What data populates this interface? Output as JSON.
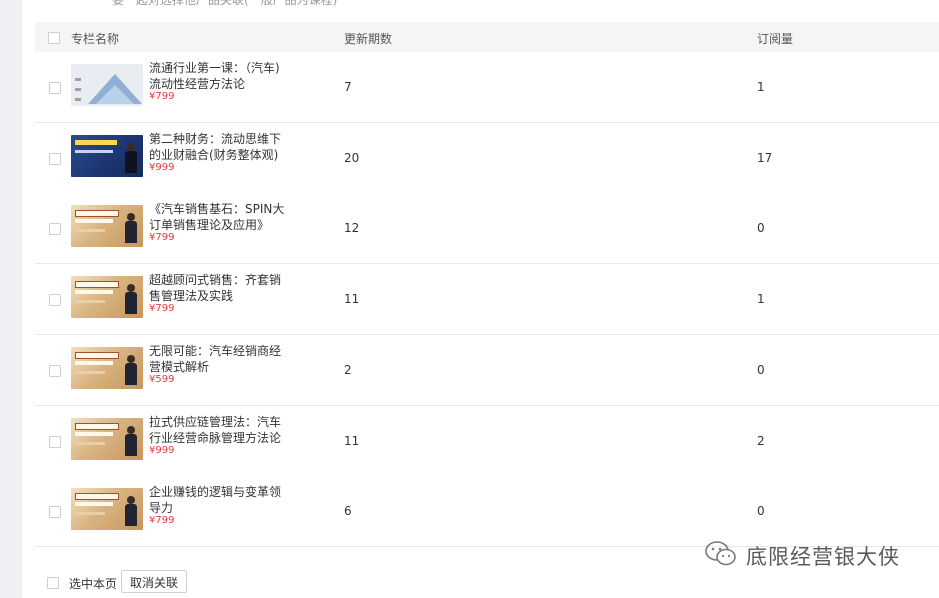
{
  "top_note": "要一起对选择他产品关联(一般产品为课程)",
  "table": {
    "headers": {
      "name": "专栏名称",
      "updates": "更新期数",
      "subscriptions": "订阅量"
    },
    "rows": [
      {
        "title": "流通行业第一课：（汽车)流动性经营方法论",
        "price": "¥799",
        "updates": "7",
        "subscriptions": "1",
        "thumb": "pyramid-diagram"
      },
      {
        "title": "第二种财务：流动思维下的业财融合(财务整体观)",
        "price": "¥999",
        "updates": "20",
        "subscriptions": "17",
        "thumb": "blue-cover"
      },
      {
        "title": "《汽车销售基石：SPIN大订单销售理论及应用》",
        "price": "¥799",
        "updates": "12",
        "subscriptions": "0",
        "thumb": "gold-cover"
      },
      {
        "title": "超越顾问式销售：齐套销售管理法及实践",
        "price": "¥799",
        "updates": "11",
        "subscriptions": "1",
        "thumb": "gold-cover"
      },
      {
        "title": "无限可能：汽车经销商经营模式解析",
        "price": "¥599",
        "updates": "2",
        "subscriptions": "0",
        "thumb": "gold-cover"
      },
      {
        "title": "拉式供应链管理法：汽车行业经营命脉管理方法论",
        "price": "¥999",
        "updates": "11",
        "subscriptions": "2",
        "thumb": "gold-cover"
      },
      {
        "title": "企业赚钱的逻辑与变革领导力",
        "price": "¥799",
        "updates": "6",
        "subscriptions": "0",
        "thumb": "gold-cover"
      }
    ]
  },
  "footer": {
    "select_page_label": "选中本页",
    "unlink_button": "取消关联"
  },
  "watermark": {
    "text": "底限经营银大侠",
    "icon": "wechat-icon"
  },
  "colors": {
    "price": "#e4393c",
    "header_bg": "#f5f5f5",
    "divider": "#e8e8e8"
  }
}
